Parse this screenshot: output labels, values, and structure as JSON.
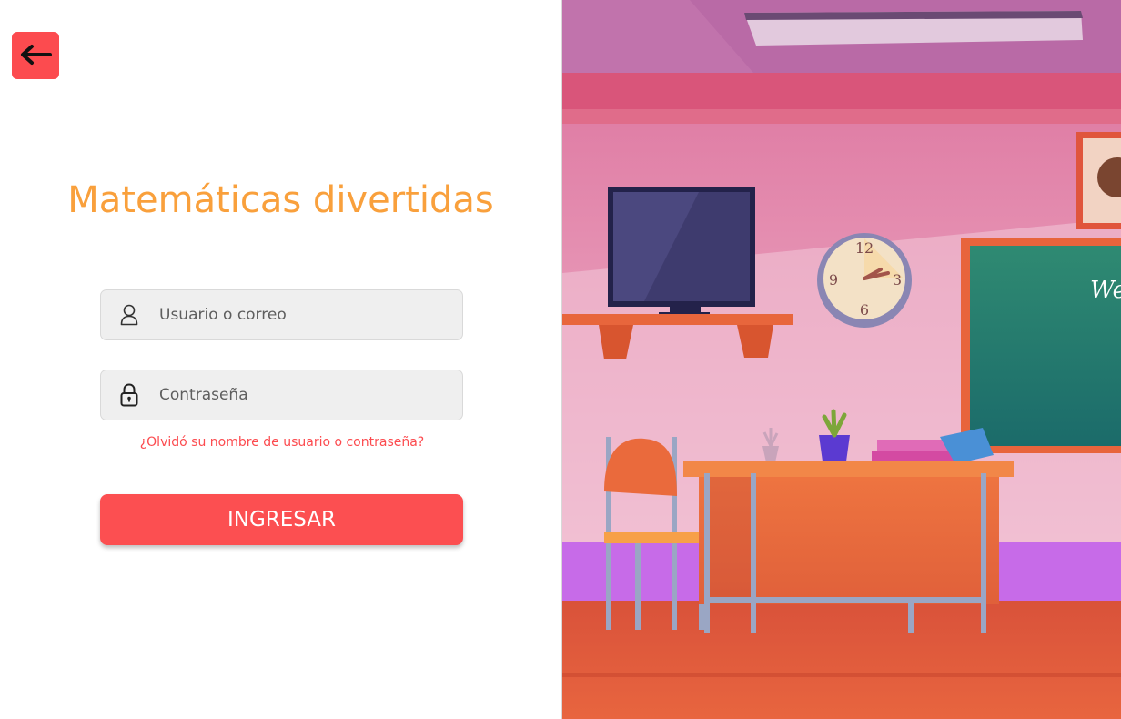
{
  "app": {
    "title": "Matemáticas divertidas"
  },
  "nav": {
    "back_icon": "arrow-left-icon"
  },
  "login_form": {
    "username": {
      "icon": "user-icon",
      "placeholder": "Usuario o correo",
      "value": ""
    },
    "password": {
      "icon": "lock-icon",
      "placeholder": "Contraseña",
      "value": ""
    },
    "forgot_link": "¿Olvidó su nombre de usuario o contraseña?",
    "submit_label": "INGRESAR"
  },
  "illustration": {
    "clock_numbers": [
      "12",
      "3",
      "6",
      "9"
    ],
    "chalkboard_text": "We"
  },
  "colors": {
    "accent_red": "#fc4b4f",
    "title_orange": "#f9a03c",
    "field_bg": "#efefef",
    "wall_pink": "#e8a2c0",
    "floor_orange": "#e0573c"
  }
}
